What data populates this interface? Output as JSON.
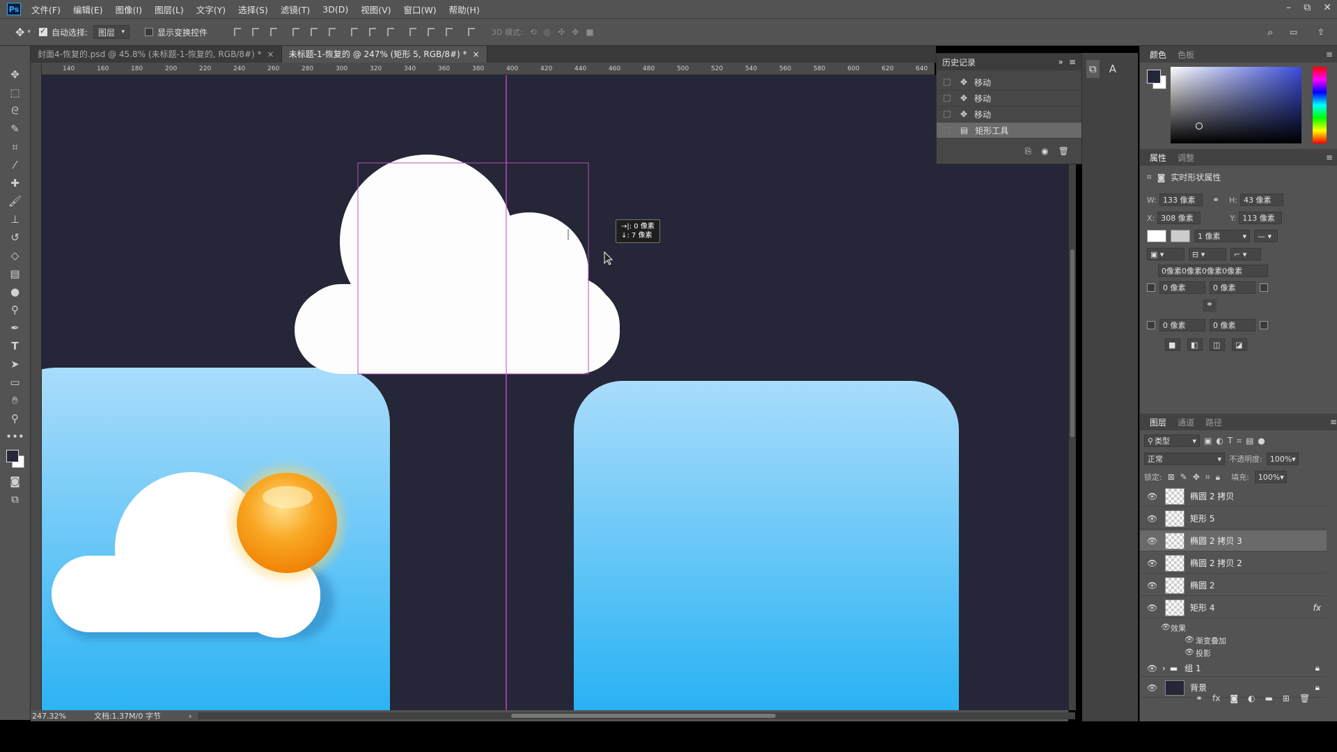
{
  "app": {
    "logo": "Ps"
  },
  "menu": [
    "文件(F)",
    "编辑(E)",
    "图像(I)",
    "图层(L)",
    "文字(Y)",
    "选择(S)",
    "滤镜(T)",
    "3D(D)",
    "视图(V)",
    "窗口(W)",
    "帮助(H)"
  ],
  "window_controls": {
    "minimize": "–",
    "restore": "⧉",
    "close": "✕"
  },
  "options": {
    "auto_select_label": "自动选择:",
    "auto_select_value": "图层",
    "show_transform_label": "显示变换控件",
    "mode_3d_label": "3D 模式:"
  },
  "tabs": [
    {
      "label": "封面4-恢复的.psd @ 45.8% (未标题-1-恢复的, RGB/8#) *",
      "close": "×"
    },
    {
      "label": "未标题-1-恢复的 @ 247% (矩形 5, RGB/8#) *",
      "close": "×"
    }
  ],
  "ruler_ticks": [
    "140",
    "160",
    "180",
    "200",
    "220",
    "240",
    "260",
    "280",
    "300",
    "320",
    "340",
    "360",
    "380",
    "400",
    "420",
    "440",
    "460",
    "480",
    "500",
    "520",
    "540",
    "560",
    "580",
    "600",
    "620",
    "640"
  ],
  "transform_tip": {
    "dx": "→|: 0 像素",
    "dy": "↓: 7 像素"
  },
  "status": {
    "zoom": "247.32%",
    "doc": "文档:1.37M/0 字节",
    "arrow": "›"
  },
  "history": {
    "title": "历史记录",
    "items": [
      {
        "label": "移动",
        "active": false
      },
      {
        "label": "移动",
        "active": false
      },
      {
        "label": "移动",
        "active": false
      },
      {
        "label": "矩形工具",
        "active": true
      }
    ]
  },
  "color_panel": {
    "tabs": [
      "颜色",
      "色板"
    ]
  },
  "properties": {
    "tabs": [
      "属性",
      "调整"
    ],
    "title": "实时形状属性",
    "w_label": "W:",
    "w": "133 像素",
    "h_label": "H:",
    "h": "43 像素",
    "x_label": "X:",
    "x": "308 像素",
    "y_label": "Y:",
    "y": "113 像素",
    "stroke_width": "1 像素",
    "corners_summary": "0像素0像素0像素0像素",
    "corner_tl": "0 像素",
    "corner_tr": "0 像素",
    "corner_bl": "0 像素",
    "corner_br": "0 像素"
  },
  "layers": {
    "tabs": [
      "图层",
      "通道",
      "路径"
    ],
    "filter": "类型",
    "blend": "正常",
    "opacity_label": "不透明度:",
    "opacity": "100%",
    "lock_label": "锁定:",
    "fill_label": "填充:",
    "fill": "100%",
    "items": [
      {
        "name": "椭圆 2 拷贝",
        "active": false
      },
      {
        "name": "矩形 5",
        "active": false
      },
      {
        "name": "椭圆 2 拷贝 3",
        "active": true
      },
      {
        "name": "椭圆 2 拷贝 2",
        "active": false
      },
      {
        "name": "椭圆 2",
        "active": false
      },
      {
        "name": "矩形 4",
        "active": false,
        "fx": "fx"
      }
    ],
    "effects_label": "效果",
    "effect_gradient": "渐变叠加",
    "effect_shadow": "投影",
    "group": "组 1",
    "background": "背景"
  },
  "colors": {
    "canvas_bg": "#252637",
    "sky_top": "#a9dcfb",
    "sky_bottom": "#12aaf2",
    "sun": "#f7941d",
    "guide": "#d659d6"
  }
}
